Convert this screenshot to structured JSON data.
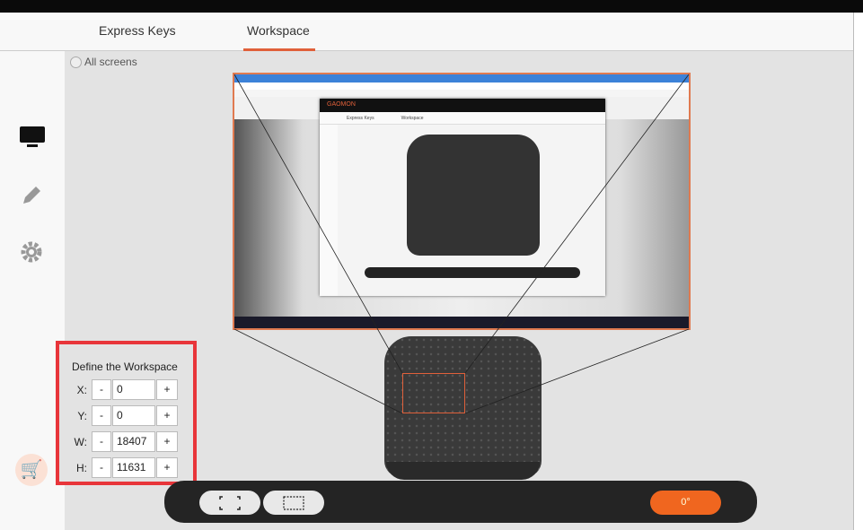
{
  "tabs": [
    {
      "label": "Express Keys",
      "active": false
    },
    {
      "label": "Workspace",
      "active": true
    }
  ],
  "all_screens_label": "All screens",
  "sidebar": {
    "items": [
      {
        "icon": "monitor-icon"
      },
      {
        "icon": "pen-icon"
      },
      {
        "icon": "gear-icon"
      }
    ],
    "cart_icon": "cart-icon"
  },
  "preview": {
    "app_logo": "GAOMON",
    "app_tabs": [
      "Express Keys",
      "Workspace"
    ]
  },
  "workspace": {
    "title": "Define the Workspace",
    "fields": [
      {
        "label": "X:",
        "value": "0"
      },
      {
        "label": "Y:",
        "value": "0"
      },
      {
        "label": "W:",
        "value": "18407"
      },
      {
        "label": "H:",
        "value": "11631"
      }
    ],
    "minus": "-",
    "plus": "+"
  },
  "toolbar": {
    "fullscreen_icon": "expand-icon",
    "area_icon": "select-area-icon",
    "rotation": "0°"
  },
  "colors": {
    "accent": "#f0661f",
    "highlight": "#e8353a"
  }
}
